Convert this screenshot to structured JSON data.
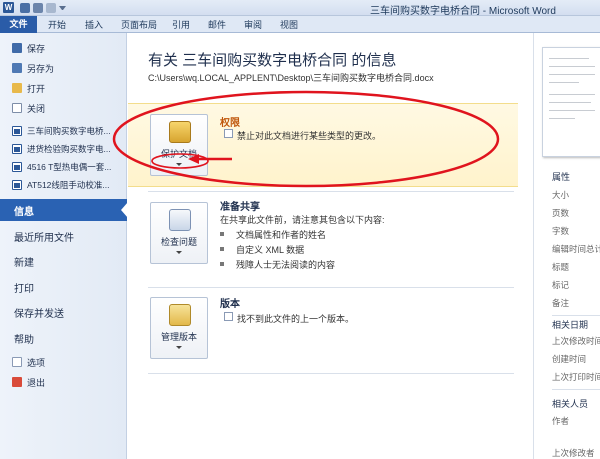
{
  "window": {
    "title": "三车间购买数字电桥合同 - Microsoft Word",
    "app_icon_letter": "W"
  },
  "ribbon_tabs": [
    "文件",
    "开始",
    "插入",
    "页面布局",
    "引用",
    "邮件",
    "审阅",
    "视图"
  ],
  "backstage": {
    "commands": [
      {
        "label": "保存",
        "icon": "save-icon"
      },
      {
        "label": "另存为",
        "icon": "save-as-icon"
      },
      {
        "label": "打开",
        "icon": "open-folder-icon"
      },
      {
        "label": "关闭",
        "icon": "close-document-icon"
      }
    ],
    "recent_docs": [
      "三车间购买数字电桥...",
      "进货检验购买数字电...",
      "4516 T型热电偶一套...",
      "AT512线阻手动校准..."
    ],
    "nav": [
      "信息",
      "最近所用文件",
      "新建",
      "打印",
      "保存并发送",
      "帮助"
    ],
    "bottom": [
      {
        "label": "选项",
        "icon": "options-icon"
      },
      {
        "label": "退出",
        "icon": "exit-icon"
      }
    ],
    "active_nav": "信息"
  },
  "info": {
    "heading": "有关 三车间购买数字电桥合同 的信息",
    "path": "C:\\Users\\wq.LOCAL_APPLENT\\Desktop\\三车间购买数字电桥合同.docx",
    "permissions": {
      "button_label": "保护文档",
      "title": "权限",
      "description": "禁止对此文档进行某些类型的更改。"
    },
    "prepare": {
      "button_label": "检查问题",
      "title": "准备共享",
      "description": "在共享此文件前，请注意其包含以下内容:",
      "bullets": [
        "文档属性和作者的姓名",
        "自定义 XML 数据",
        "残障人士无法阅读的内容"
      ]
    },
    "versions": {
      "button_label": "管理版本",
      "title": "版本",
      "description": "找不到此文件的上一个版本。"
    }
  },
  "properties": {
    "heading": "属性",
    "items": [
      "大小",
      "页数",
      "字数",
      "编辑时间总计",
      "标题",
      "标记",
      "备注"
    ],
    "dates_heading": "相关日期",
    "dates": [
      "上次修改时间",
      "创建时间",
      "上次打印时间"
    ],
    "people_heading": "相关人员",
    "people": [
      "作者",
      "上次修改者"
    ]
  },
  "colors": {
    "file_tab": "#2a5ca8",
    "active_nav": "#2a62b3",
    "permission_title": "#c0570c",
    "annotation": "#e0141e"
  }
}
